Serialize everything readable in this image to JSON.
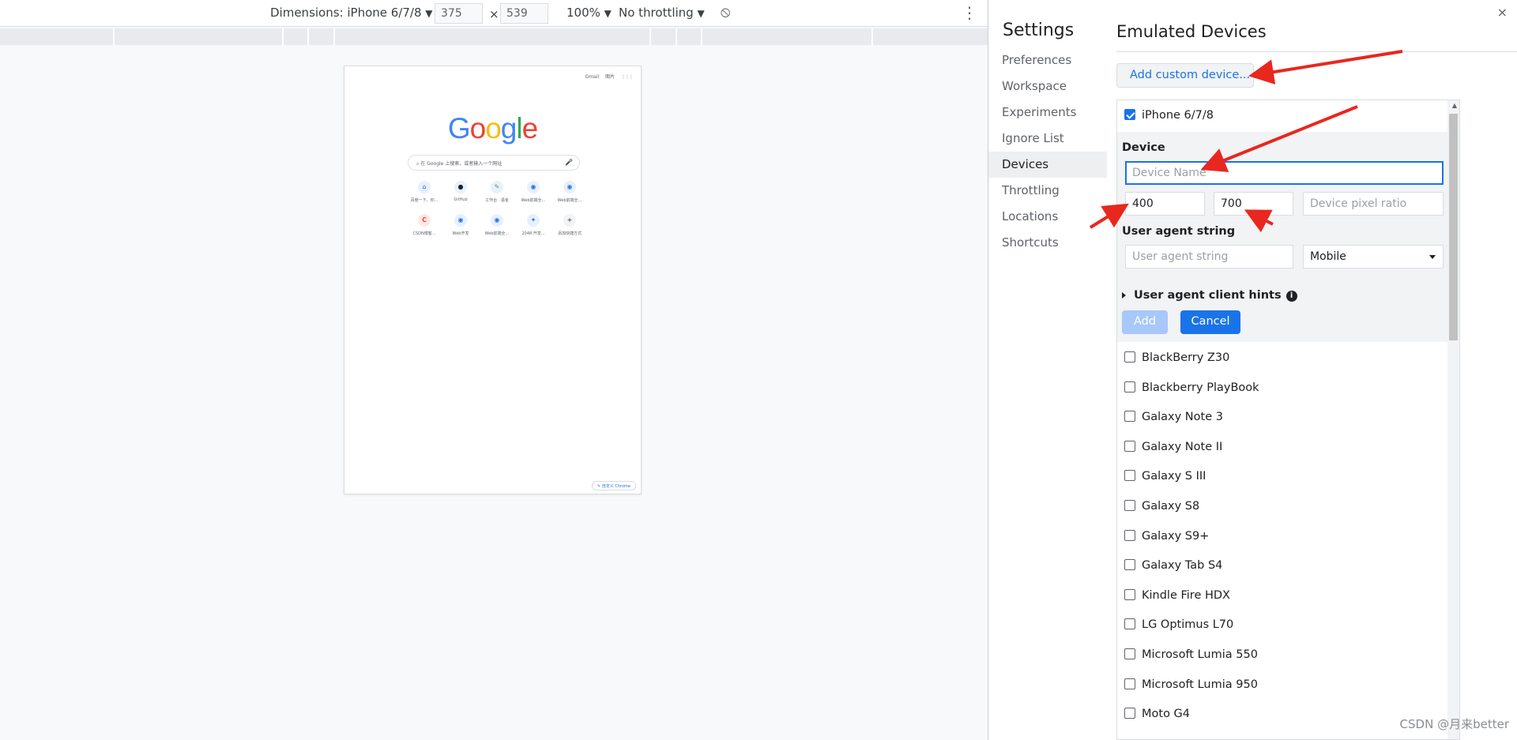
{
  "toolbar": {
    "dimensions_label": "Dimensions: iPhone 6/7/8",
    "width": "375",
    "height": "539",
    "times": "×",
    "zoom": "100%",
    "throttling": "No throttling",
    "dropdown_glyph": "▼",
    "rotate_glyph": "⦸",
    "more_glyph": "⋮"
  },
  "preview": {
    "top_links": [
      "Gmail",
      "图片"
    ],
    "apps_glyph": "⋮⋮⋮",
    "logo_letters": [
      {
        "ch": "G",
        "color": "#4285F4"
      },
      {
        "ch": "o",
        "color": "#EA4335"
      },
      {
        "ch": "o",
        "color": "#FBBC05"
      },
      {
        "ch": "g",
        "color": "#4285F4"
      },
      {
        "ch": "l",
        "color": "#34A853"
      },
      {
        "ch": "e",
        "color": "#EA4335"
      }
    ],
    "search_placeholder": "在 Google 上搜索，或者输入一个网址",
    "search_icon": "⌕",
    "mic_icon": "🎤",
    "shortcuts_row1": [
      {
        "icon": "⌂",
        "label": "百度一下，你..."
      },
      {
        "icon": "●",
        "label": "GitHub"
      },
      {
        "icon": "✎",
        "label": "工作台 · 语雀"
      },
      {
        "icon": "◉",
        "label": "Web前端全..."
      },
      {
        "icon": "◉",
        "label": "Web前端全..."
      }
    ],
    "shortcuts_row2": [
      {
        "icon": "C",
        "label": "CSDN博客..."
      },
      {
        "icon": "◉",
        "label": "Web开发"
      },
      {
        "icon": "◉",
        "label": "Web前端全..."
      },
      {
        "icon": "✦",
        "label": "2048 开发..."
      },
      {
        "icon": "+",
        "label": "添加快捷方式"
      }
    ],
    "customize_label": "✎ 自定义 Chrome"
  },
  "settings": {
    "close_glyph": "×",
    "title": "Settings",
    "nav": [
      "Preferences",
      "Workspace",
      "Experiments",
      "Ignore List",
      "Devices",
      "Throttling",
      "Locations",
      "Shortcuts"
    ],
    "active_nav": "Devices"
  },
  "emulated": {
    "title": "Emulated Devices",
    "add_custom_label": "Add custom device...",
    "checked_device": "iPhone 6/7/8",
    "editor": {
      "device_label": "Device",
      "device_name_placeholder": "Device Name",
      "width_value": "400",
      "height_value": "700",
      "dpr_placeholder": "Device pixel ratio",
      "ua_label": "User agent string",
      "ua_placeholder": "User agent string",
      "ua_type": "Mobile",
      "hints_label": "User agent client hints",
      "info_glyph": "i",
      "add_button": "Add",
      "cancel_button": "Cancel"
    },
    "devices": [
      "BlackBerry Z30",
      "Blackberry PlayBook",
      "Galaxy Note 3",
      "Galaxy Note II",
      "Galaxy S III",
      "Galaxy S8",
      "Galaxy S9+",
      "Galaxy Tab S4",
      "Kindle Fire HDX",
      "LG Optimus L70",
      "Microsoft Lumia 550",
      "Microsoft Lumia 950",
      "Moto G4"
    ]
  },
  "watermark": "CSDN @月来better",
  "colors": {
    "accent": "#1a73e8",
    "annotation_arrow": "#e8271f"
  }
}
